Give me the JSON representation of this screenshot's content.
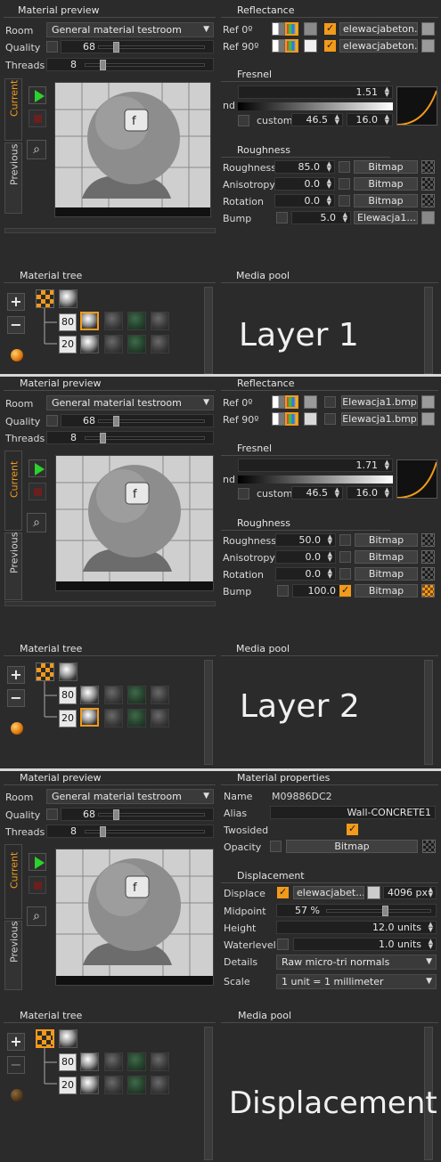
{
  "screens": [
    {
      "preview_title": "Material preview",
      "room_label": "Room",
      "room_value": "General material testroom",
      "quality_label": "Quality",
      "quality_value": "68",
      "threads_label": "Threads",
      "threads_value": "8",
      "tab_current": "Current",
      "tab_previous": "Previous",
      "reflectance_title": "Reflectance",
      "ref0_label": "Ref 0º",
      "ref0_map": "elewacjabeton...",
      "ref90_label": "Ref 90º",
      "ref90_map": "elewacjabeton...",
      "fresnel_title": "Fresnel",
      "nd_label": "nd",
      "nd_value": "1.51",
      "nd_fraction": 0.51,
      "custom_label": "custom",
      "custom_a": "46.5",
      "custom_b": "16.0",
      "roughness_title": "Roughness",
      "rows": [
        {
          "label": "Roughness",
          "value": "85.0",
          "map": "Bitmap"
        },
        {
          "label": "Anisotropy",
          "value": "0.0",
          "map": "Bitmap"
        },
        {
          "label": "Rotation",
          "value": "0.0",
          "map": "Bitmap"
        },
        {
          "label": "Bump",
          "value": "5.0",
          "map": "Elewacja1...."
        }
      ],
      "tree_title": "Material tree",
      "tree_n1": "80",
      "tree_n2": "20",
      "media_title": "Media pool",
      "caption": "Layer 1"
    },
    {
      "preview_title": "Material preview",
      "room_label": "Room",
      "room_value": "General material testroom",
      "quality_label": "Quality",
      "quality_value": "68",
      "threads_label": "Threads",
      "threads_value": "8",
      "tab_current": "Current",
      "tab_previous": "Previous",
      "reflectance_title": "Reflectance",
      "ref0_label": "Ref 0º",
      "ref0_map": "Elewacja1.bmp",
      "ref90_label": "Ref 90º",
      "ref90_map": "Elewacja1.bmp",
      "fresnel_title": "Fresnel",
      "nd_label": "nd",
      "nd_value": "1.71",
      "nd_fraction": 0.71,
      "custom_label": "custom",
      "custom_a": "46.5",
      "custom_b": "16.0",
      "roughness_title": "Roughness",
      "rows": [
        {
          "label": "Roughness",
          "value": "50.0",
          "map": "Bitmap"
        },
        {
          "label": "Anisotropy",
          "value": "0.0",
          "map": "Bitmap"
        },
        {
          "label": "Rotation",
          "value": "0.0",
          "map": "Bitmap"
        },
        {
          "label": "Bump",
          "value": "100.0",
          "map": "Bitmap"
        }
      ],
      "tree_title": "Material tree",
      "tree_n1": "80",
      "tree_n2": "20",
      "media_title": "Media pool",
      "caption": "Layer 2"
    },
    {
      "preview_title": "Material preview",
      "room_label": "Room",
      "room_value": "General material testroom",
      "quality_label": "Quality",
      "quality_value": "68",
      "threads_label": "Threads",
      "threads_value": "8",
      "tab_current": "Current",
      "tab_previous": "Previous",
      "props_title": "Material properties",
      "name_label": "Name",
      "name_value": "M09886DC2",
      "alias_label": "Alias",
      "alias_value": "Wall-CONCRETE1",
      "twosided_label": "Twosided",
      "opacity_label": "Opacity",
      "opacity_map": "Bitmap",
      "disp_title": "Displacement",
      "displace_label": "Displace",
      "displace_map": "elewacjabet...",
      "displace_px": "4096 px",
      "midpoint_label": "Midpoint",
      "midpoint_value": "57 %",
      "midpoint_fraction": 0.57,
      "height_label": "Height",
      "height_value": "12.0 units",
      "waterlevel_label": "Waterlevel",
      "waterlevel_value": "1.0 units",
      "details_label": "Details",
      "details_value": "Raw micro-tri normals",
      "scale_label": "Scale",
      "scale_value": "1 unit = 1 millimeter",
      "tree_title": "Material tree",
      "tree_n1": "80",
      "tree_n2": "20",
      "media_title": "Media pool",
      "caption": "Displacement"
    }
  ]
}
